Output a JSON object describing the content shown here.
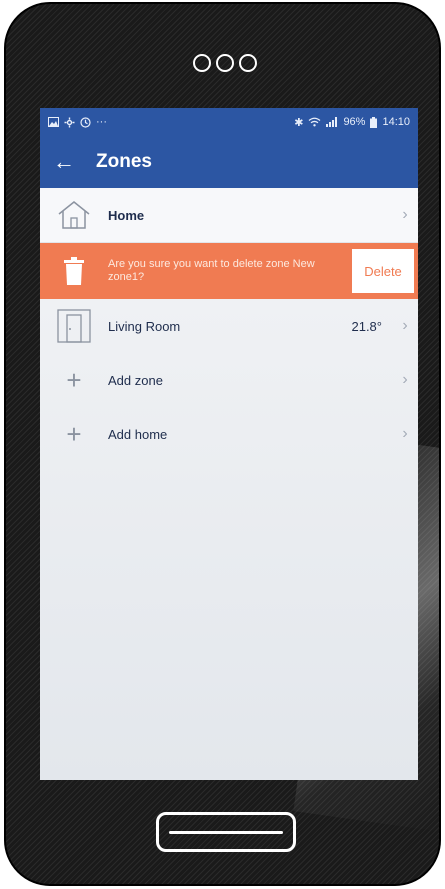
{
  "status": {
    "icons_left": [
      "image-icon",
      "settings-icon",
      "clock-icon",
      "more-dots"
    ],
    "more_dots": "···",
    "battery": "96%",
    "time": "14:10"
  },
  "appbar": {
    "title": "Zones"
  },
  "rows": {
    "home": {
      "label": "Home"
    },
    "confirm": {
      "message": "Are you sure you want to delete zone New zone1?",
      "delete_label": "Delete"
    },
    "living": {
      "label": "Living Room",
      "value": "21.8°"
    },
    "add_zone": {
      "label": "Add zone"
    },
    "add_home": {
      "label": "Add home"
    }
  },
  "colors": {
    "primary": "#2c56a3",
    "warning": "#f07b52",
    "frame": "#1a1a1a"
  }
}
